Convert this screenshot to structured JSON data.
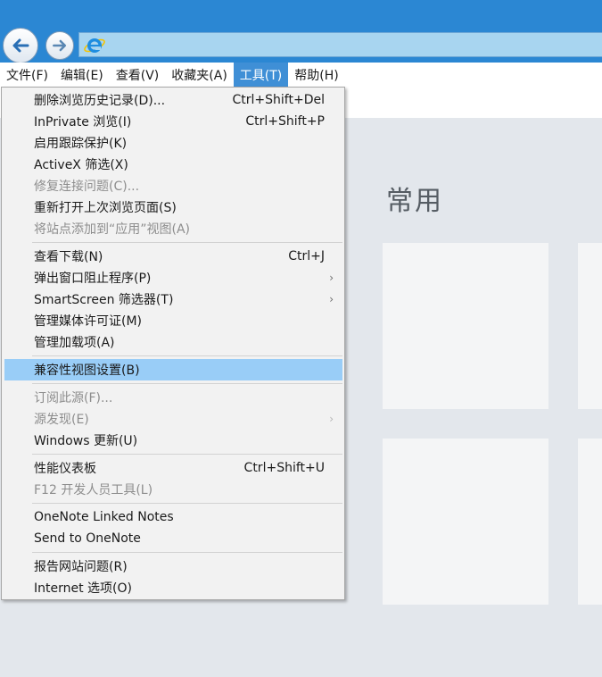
{
  "menubar": {
    "items": [
      {
        "label": "文件(F)"
      },
      {
        "label": "编辑(E)"
      },
      {
        "label": "查看(V)"
      },
      {
        "label": "收藏夹(A)"
      },
      {
        "label": "工具(T)"
      },
      {
        "label": "帮助(H)"
      }
    ]
  },
  "content": {
    "section_title": "常用"
  },
  "tools_menu": {
    "items": [
      {
        "label": "删除浏览历史记录(D)...",
        "shortcut": "Ctrl+Shift+Del"
      },
      {
        "label": "InPrivate 浏览(I)",
        "shortcut": "Ctrl+Shift+P"
      },
      {
        "label": "启用跟踪保护(K)"
      },
      {
        "label": "ActiveX 筛选(X)"
      },
      {
        "label": "修复连接问题(C)..."
      },
      {
        "label": "重新打开上次浏览页面(S)"
      },
      {
        "label": "将站点添加到“应用”视图(A)"
      },
      {
        "label": "查看下载(N)",
        "shortcut": "Ctrl+J"
      },
      {
        "label": "弹出窗口阻止程序(P)"
      },
      {
        "label": "SmartScreen 筛选器(T)"
      },
      {
        "label": "管理媒体许可证(M)"
      },
      {
        "label": "管理加载项(A)"
      },
      {
        "label": "兼容性视图设置(B)"
      },
      {
        "label": "订阅此源(F)..."
      },
      {
        "label": "源发现(E)"
      },
      {
        "label": "Windows 更新(U)"
      },
      {
        "label": "性能仪表板",
        "shortcut": "Ctrl+Shift+U"
      },
      {
        "label": "F12 开发人员工具(L)"
      },
      {
        "label": "OneNote Linked Notes"
      },
      {
        "label": "Send to OneNote"
      },
      {
        "label": "报告网站问题(R)"
      },
      {
        "label": "Internet 选项(O)"
      }
    ]
  },
  "icons": {
    "back": "back-arrow-icon",
    "forward": "forward-arrow-icon",
    "site": "internet-explorer-logo-icon",
    "submenu": "chevron-right-icon"
  },
  "colors": {
    "titlebar": "#2b87d3",
    "menu_active": "#3f8fd6",
    "menu_highlight": "#99cdf7",
    "disabled_text": "#8d8d8d"
  }
}
